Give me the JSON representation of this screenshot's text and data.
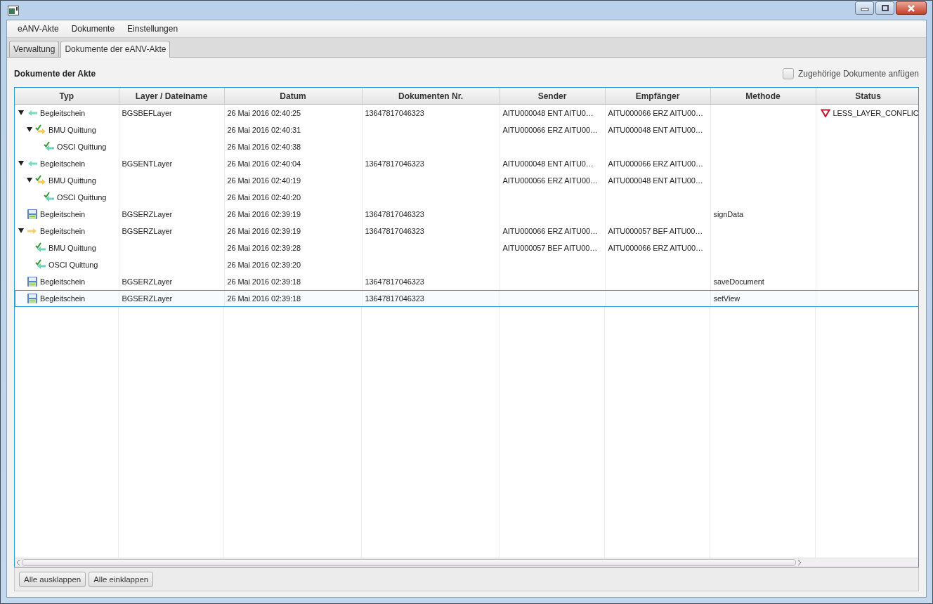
{
  "menu": [
    "eANV-Akte",
    "Dokumente",
    "Einstellungen"
  ],
  "tabs": [
    {
      "label": "Verwaltung",
      "selected": false
    },
    {
      "label": "Dokumente der  eANV-Akte",
      "selected": true
    }
  ],
  "section_title": "Dokumente der Akte",
  "attach_option": {
    "label": "Zugehörige Dokumente anfügen",
    "checked": false
  },
  "table": {
    "columns": [
      "Typ",
      "Layer / Dateiname",
      "Datum",
      "Dokumenten Nr.",
      "Sender",
      "Empfänger",
      "Methode",
      "Status"
    ],
    "rows": [
      {
        "kind": "incoming",
        "typ": "Begleitschein",
        "layer": "BGSBEFLayer",
        "datum": "26 Mai 2016 02:40:25",
        "nr": "13647817046323",
        "sender": "AITU000048 ENT AITU0…",
        "empfaenger": "AITU000066 ERZ AITU00…",
        "status": {
          "kind": "conflict",
          "text": "LESS_LAYER_CONFLIC"
        },
        "selected": false,
        "expanded": true,
        "children": [
          {
            "kind": "receipt_yellow",
            "typ": "BMU Quittung",
            "datum": "26 Mai 2016 02:40:31",
            "sender": "AITU000066 ERZ AITU00…",
            "empfaenger": "AITU000048 ENT AITU00…",
            "selected": false,
            "expanded": true,
            "children": [
              {
                "kind": "receipt_teal",
                "typ": "OSCI Quittung",
                "datum": "26 Mai 2016 02:40:38",
                "selected": false
              }
            ]
          }
        ]
      },
      {
        "kind": "incoming",
        "typ": "Begleitschein",
        "layer": "BGSENTLayer",
        "datum": "26 Mai 2016 02:40:04",
        "nr": "13647817046323",
        "sender": "AITU000048 ENT AITU0…",
        "empfaenger": "AITU000066 ERZ AITU00…",
        "selected": false,
        "expanded": true,
        "children": [
          {
            "kind": "receipt_yellow",
            "typ": "BMU Quittung",
            "datum": "26 Mai 2016 02:40:19",
            "sender": "AITU000066 ERZ AITU00…",
            "empfaenger": "AITU000048 ENT AITU00…",
            "selected": false,
            "expanded": true,
            "children": [
              {
                "kind": "receipt_teal",
                "typ": "OSCI Quittung",
                "datum": "26 Mai 2016 02:40:20",
                "selected": false
              }
            ]
          }
        ]
      },
      {
        "kind": "saved",
        "typ": "Begleitschein",
        "layer": "BGSERZLayer",
        "datum": "26 Mai 2016 02:39:19",
        "nr": "13647817046323",
        "methode": "signData",
        "selected": false
      },
      {
        "kind": "outgoing",
        "typ": "Begleitschein",
        "layer": "BGSERZLayer",
        "datum": "26 Mai 2016 02:39:19",
        "nr": "13647817046323",
        "sender": "AITU000066 ERZ AITU00…",
        "empfaenger": "AITU000057 BEF AITU00…",
        "selected": false,
        "expanded": true,
        "children": [
          {
            "kind": "receipt_teal",
            "typ": "BMU Quittung",
            "datum": "26 Mai 2016 02:39:28",
            "sender": "AITU000057 BEF AITU00…",
            "empfaenger": "AITU000066 ERZ AITU00…",
            "selected": false
          },
          {
            "kind": "receipt_teal",
            "typ": "OSCI Quittung",
            "datum": "26 Mai 2016 02:39:20",
            "selected": false
          }
        ]
      },
      {
        "kind": "saved",
        "typ": "Begleitschein",
        "layer": "BGSERZLayer",
        "datum": "26 Mai 2016 02:39:18",
        "nr": "13647817046323",
        "methode": "saveDocument",
        "selected": false
      },
      {
        "kind": "saved",
        "typ": "Begleitschein",
        "layer": "BGSERZLayer",
        "datum": "26 Mai 2016 02:39:18",
        "nr": "13647817046323",
        "methode": "setView",
        "selected": true
      }
    ]
  },
  "buttons": [
    "Alle ausklappen",
    "Alle einklappen"
  ]
}
